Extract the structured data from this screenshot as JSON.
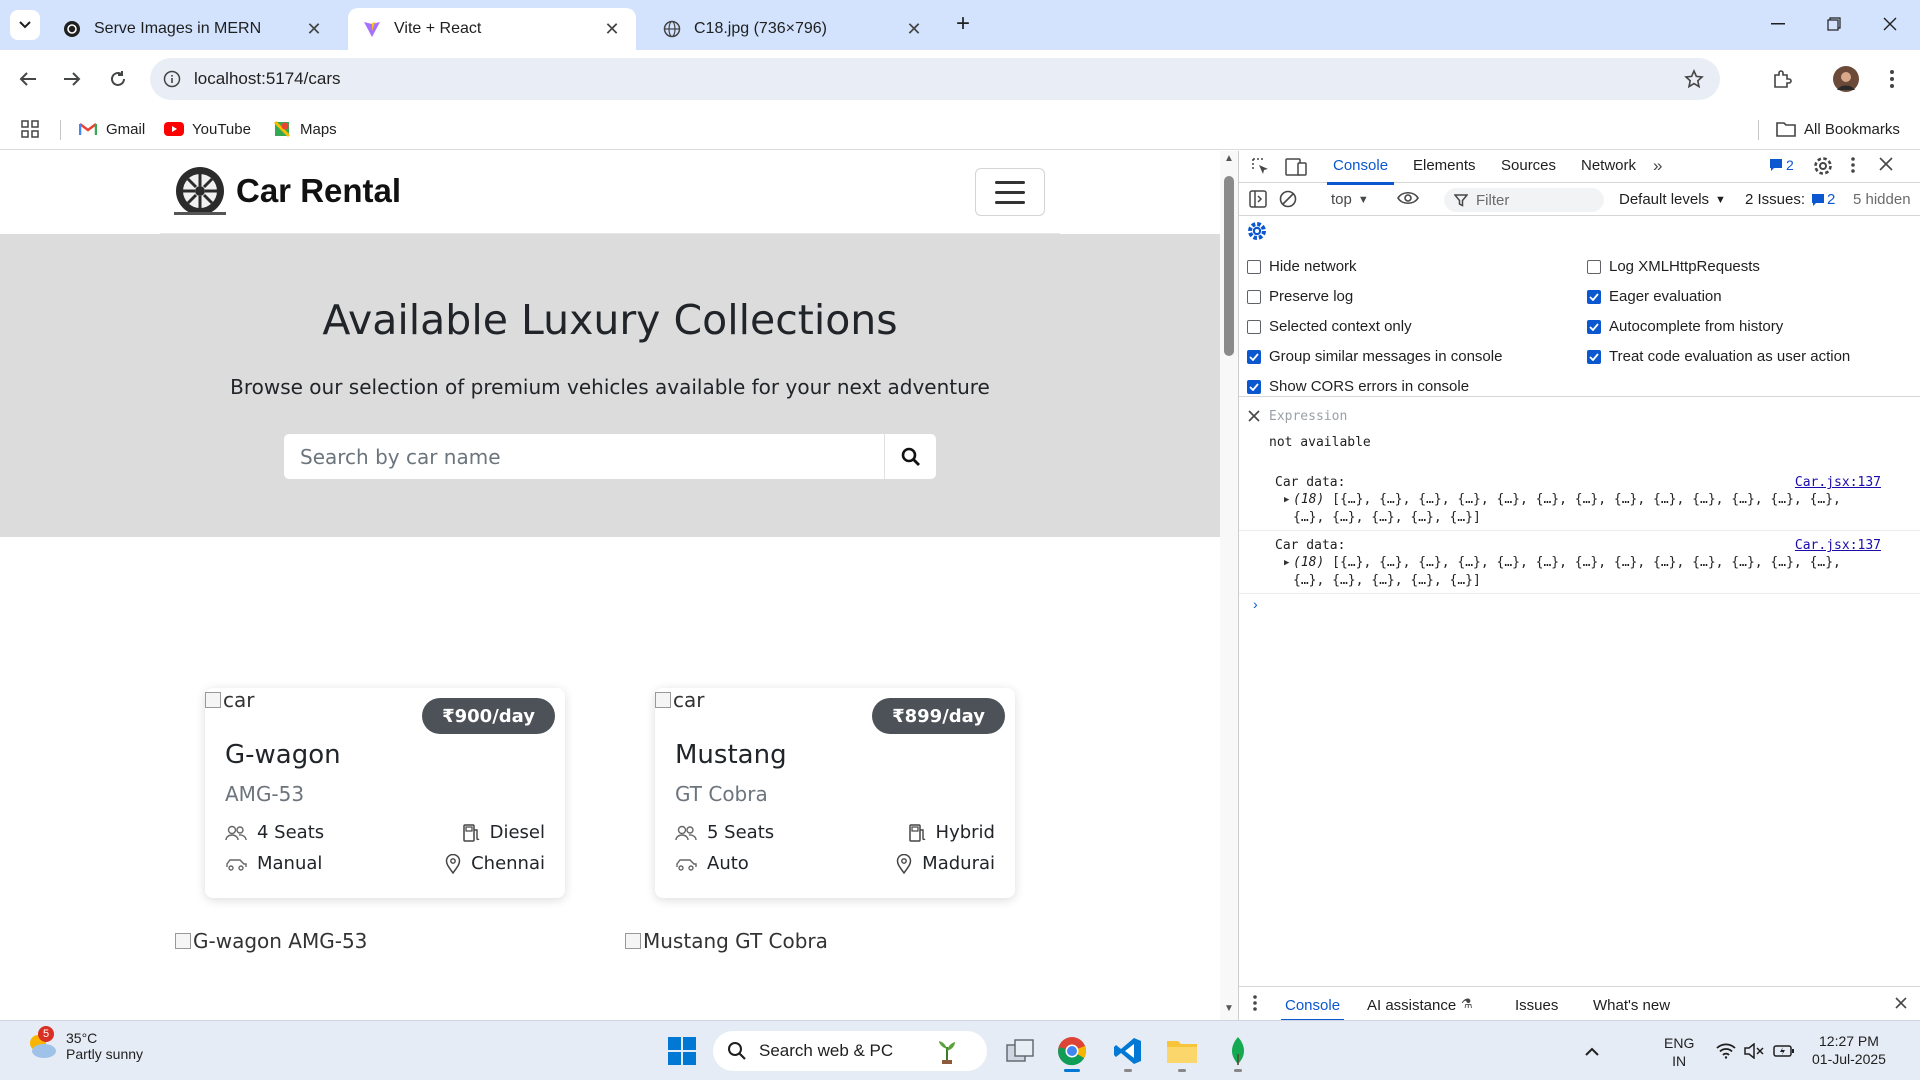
{
  "browser": {
    "tabs": [
      {
        "title": "Serve Images in MERN",
        "active": false
      },
      {
        "title": "Vite + React",
        "active": true
      },
      {
        "title": "C18.jpg (736×796)",
        "active": false
      }
    ],
    "url": "localhost:5174/cars",
    "bookmarks": [
      "Gmail",
      "YouTube",
      "Maps"
    ],
    "all_bookmarks": "All Bookmarks"
  },
  "page": {
    "brand": "Car Rental",
    "hero_title": "Available Luxury Collections",
    "hero_subtitle": "Browse our selection of premium vehicles available for your next adventure",
    "search_placeholder": "Search by car name",
    "cards": [
      {
        "img_alt": "car",
        "price": "₹900/day",
        "name": "G-wagon",
        "model": "AMG-53",
        "seats": "4 Seats",
        "fuel": "Diesel",
        "transmission": "Manual",
        "location": "Chennai"
      },
      {
        "img_alt": "car",
        "price": "₹899/day",
        "name": "Mustang",
        "model": "GT Cobra",
        "seats": "5 Seats",
        "fuel": "Hybrid",
        "transmission": "Auto",
        "location": "Madurai"
      }
    ],
    "below_alts": [
      "G-wagon AMG-53",
      "Mustang GT Cobra"
    ]
  },
  "devtools": {
    "tabs": [
      "Console",
      "Elements",
      "Sources",
      "Network"
    ],
    "issues_count": "2",
    "context": "top",
    "filter_placeholder": "Filter",
    "levels": "Default levels",
    "issues_label": "2 Issues:",
    "issues_badge": "2",
    "hidden": "5 hidden",
    "settings_left": [
      {
        "label": "Hide network",
        "checked": false
      },
      {
        "label": "Preserve log",
        "checked": false
      },
      {
        "label": "Selected context only",
        "checked": false
      },
      {
        "label": "Group similar messages in console",
        "checked": true
      },
      {
        "label": "Show CORS errors in console",
        "checked": true
      }
    ],
    "settings_right": [
      {
        "label": "Log XMLHttpRequests",
        "checked": false
      },
      {
        "label": "Eager evaluation",
        "checked": true
      },
      {
        "label": "Autocomplete from history",
        "checked": true
      },
      {
        "label": "Treat code evaluation as user action",
        "checked": true
      }
    ],
    "expression_placeholder": "Expression",
    "expression_value": "not available",
    "logs": [
      {
        "label": "Car data:",
        "source": "Car.jsx:137",
        "count": "(18)",
        "line1": "[{…}, {…}, {…}, {…}, {…}, {…}, {…}, {…}, {…}, {…}, {…}, {…}, {…},",
        "line2": "{…}, {…}, {…}, {…}, {…}]"
      },
      {
        "label": "Car data:",
        "source": "Car.jsx:137",
        "count": "(18)",
        "line1": "[{…}, {…}, {…}, {…}, {…}, {…}, {…}, {…}, {…}, {…}, {…}, {…}, {…},",
        "line2": "{…}, {…}, {…}, {…}, {…}]"
      }
    ],
    "drawer_tabs": [
      "Console",
      "AI assistance",
      "Issues",
      "What's new"
    ]
  },
  "taskbar": {
    "weather_badge": "5",
    "temperature": "35°C",
    "weather": "Partly sunny",
    "search_placeholder": "Search web & PC",
    "lang": "ENG",
    "region": "IN",
    "time": "12:27 PM",
    "date": "01-Jul-2025"
  },
  "colors": {
    "accent": "#0b57d0",
    "tabstrip": "#d3e3fd",
    "hero_bg": "#dcdcdc",
    "price_badge": "#4d5258"
  },
  "icons": [
    "tab-search-icon",
    "chatgpt-favicon",
    "vite-favicon",
    "globe-favicon",
    "back-arrow-icon",
    "forward-arrow-icon",
    "reload-icon",
    "site-info-icon",
    "bookmark-star-icon",
    "extensions-icon",
    "profile-avatar",
    "kebab-menu-icon",
    "apps-grid-icon",
    "gmail-icon",
    "youtube-icon",
    "maps-icon",
    "folder-icon",
    "wheel-logo",
    "hamburger-icon",
    "search-icon",
    "seats-icon",
    "fuel-icon",
    "car-icon",
    "location-pin-icon"
  ]
}
